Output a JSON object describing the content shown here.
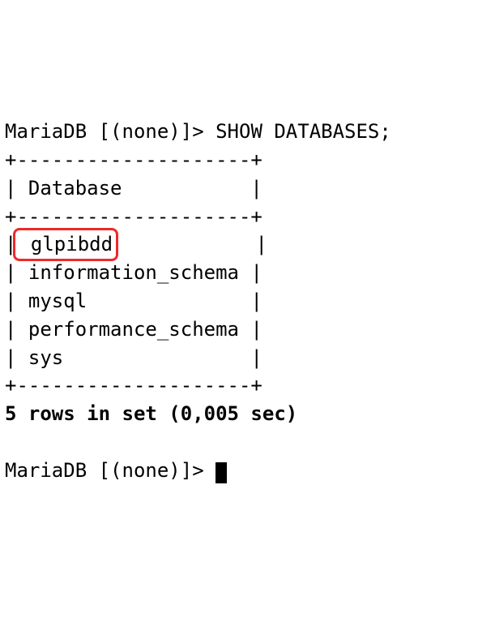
{
  "prompt": {
    "prefix": "MariaDB [(none)]> ",
    "command": "SHOW DATABASES;"
  },
  "table": {
    "separator": "+--------------------+",
    "header": "| Database           |",
    "rows": [
      {
        "name": "glpibdd",
        "cell": " glpibdd",
        "pad": "            |",
        "highlight": true
      },
      {
        "name": "information_schema",
        "cell": " information_schema ",
        "pad": "|",
        "highlight": false
      },
      {
        "name": "mysql",
        "cell": " mysql              ",
        "pad": "|",
        "highlight": false
      },
      {
        "name": "performance_schema",
        "cell": " performance_schema ",
        "pad": "|",
        "highlight": false
      },
      {
        "name": "sys",
        "cell": " sys                ",
        "pad": "|",
        "highlight": false
      }
    ]
  },
  "result_summary": "5 rows in set (0,005 sec)",
  "prompt2": "MariaDB [(none)]> "
}
